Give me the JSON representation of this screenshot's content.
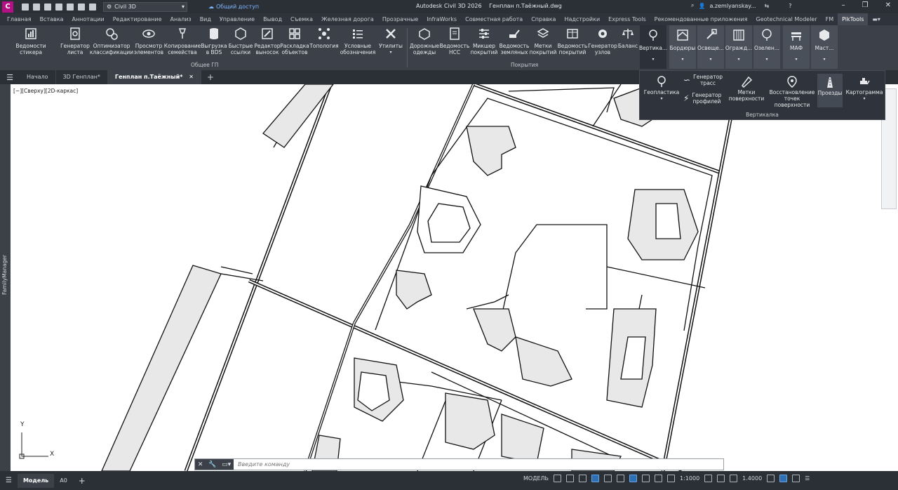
{
  "titlebar": {
    "workspace": "Civil 3D",
    "share": "Общий доступ",
    "app_name": "Autodesk Civil 3D 2026",
    "file_name": "Генплан п.Таёжный.dwg",
    "user": "a.zemlyanskay..."
  },
  "menu_tabs": [
    "Главная",
    "Вставка",
    "Аннотации",
    "Редактирование",
    "Анализ",
    "Вид",
    "Управление",
    "Вывод",
    "Съемка",
    "Железная дорога",
    "Прозрачные",
    "InfraWorks",
    "Совместная работа",
    "Справка",
    "Надстройки",
    "Express Tools",
    "Рекомендованные приложения",
    "Geotechnical Modeler",
    "FM",
    "PikTools"
  ],
  "ribbon": {
    "general_panel": "Общее ГП",
    "coverings_panel": "Покрытия",
    "buttons": {
      "b1": "Ведомости стикера",
      "b2": "Генератор листа",
      "b3": "Оптимизатор классификации",
      "b4": "Просмотр элементов",
      "b5": "Копирование семейства",
      "b6": "Выгрузка в BDS",
      "b7": "Быстрые ссылки",
      "b8": "Редактор выносок",
      "b9": "Раскладка объектов",
      "b10": "Топология",
      "b11": "Условные обозначения",
      "b12": "Утилиты",
      "b13": "Дорожные одежды",
      "b14": "Ведомость НСС",
      "b15": "Микшер покрытий",
      "b16": "Ведомость земляных",
      "b17": "Метки покрытий",
      "b18": "Ведомость покрытий",
      "b19": "Генератор узлов",
      "b20": "Баланс"
    },
    "pik": {
      "p1": "Вертика...",
      "p2": "Бордюры",
      "p3": "Освеще...",
      "p4": "Огражд...",
      "p5": "Озелен...",
      "p6": "МАФ",
      "p7": "Маст..."
    }
  },
  "dropdown": {
    "geoplastics": "Геопластика",
    "route_gen": "Генератор трасс",
    "profile_gen": "Генератор профилей",
    "surface_labels": "Метки поверхности",
    "restore_points": "Восстановление точек поверхности",
    "passages": "Проезды",
    "cartogram": "Картограмма",
    "panel_title": "Вертикалка"
  },
  "doc_tabs": [
    "Начало",
    "3D Генплан*",
    "Генплан п.Таёжный*"
  ],
  "view_label": "[−][Сверху][2D-каркас]",
  "left_palette": "FamilyManager",
  "command_line": {
    "placeholder": "Введите команду"
  },
  "status": {
    "tab_model": "Модель",
    "tab_a0": "A0",
    "model_label": "МОДЕЛЬ",
    "scale": "1:1000",
    "lineweight": "1.4000"
  },
  "ucs": {
    "x": "X",
    "y": "Y"
  },
  "colors": {
    "accent": "#2f6fb3",
    "brand": "#b40f84"
  }
}
